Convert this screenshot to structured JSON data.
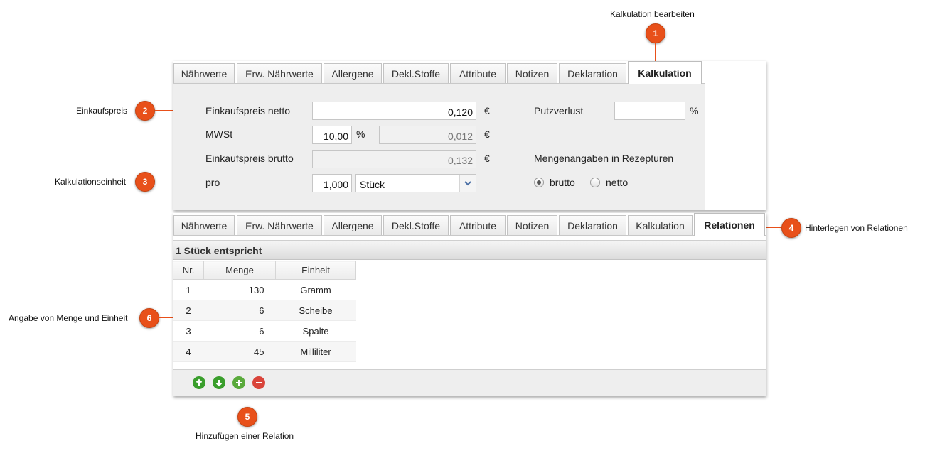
{
  "callouts": {
    "c1": {
      "num": "1",
      "text": "Kalkulation bearbeiten"
    },
    "c2": {
      "num": "2",
      "text": "Einkaufspreis"
    },
    "c3": {
      "num": "3",
      "text": "Kalkulationseinheit"
    },
    "c4": {
      "num": "4",
      "text": "Hinterlegen von Relationen"
    },
    "c5": {
      "num": "5",
      "text": "Hinzufügen einer Relation"
    },
    "c6": {
      "num": "6",
      "text": "Angabe von Menge und Einheit"
    }
  },
  "tabs_top": [
    "Nährwerte",
    "Erw. Nährwerte",
    "Allergene",
    "Dekl.Stoffe",
    "Attribute",
    "Notizen",
    "Deklaration",
    "Kalkulation"
  ],
  "tabs_bottom": [
    "Nährwerte",
    "Erw. Nährwerte",
    "Allergene",
    "Dekl.Stoffe",
    "Attribute",
    "Notizen",
    "Deklaration",
    "Kalkulation",
    "Relationen"
  ],
  "form": {
    "ek_netto_label": "Einkaufspreis netto",
    "ek_netto_value": "0,120",
    "currency": "€",
    "mwst_label": "MWSt",
    "mwst_rate": "10,00",
    "percent": "%",
    "mwst_amount": "0,012",
    "ek_brutto_label": "Einkaufspreis brutto",
    "ek_brutto_value": "0,132",
    "pro_label": "pro",
    "pro_value": "1,000",
    "unit_selected": "Stück",
    "putzverlust_label": "Putzverlust",
    "putzverlust_value": "",
    "mengen_label": "Mengenangaben in Rezepturen",
    "radio_brutto": "brutto",
    "radio_netto": "netto",
    "radio_selected": "brutto"
  },
  "relations": {
    "heading": "1 Stück entspricht",
    "columns": [
      "Nr.",
      "Menge",
      "Einheit"
    ],
    "rows": [
      {
        "nr": "1",
        "menge": "130",
        "einheit": "Gramm"
      },
      {
        "nr": "2",
        "menge": "6",
        "einheit": "Scheibe"
      },
      {
        "nr": "3",
        "menge": "6",
        "einheit": "Spalte"
      },
      {
        "nr": "4",
        "menge": "45",
        "einheit": "Milliliter"
      }
    ]
  },
  "toolbar_icons": [
    "arrow-up-icon",
    "arrow-down-icon",
    "add-icon",
    "remove-icon"
  ],
  "colors": {
    "callout": "#e8501a",
    "up_down": "#3a9e2c",
    "add": "#5aaa3c",
    "remove": "#d9443a"
  }
}
